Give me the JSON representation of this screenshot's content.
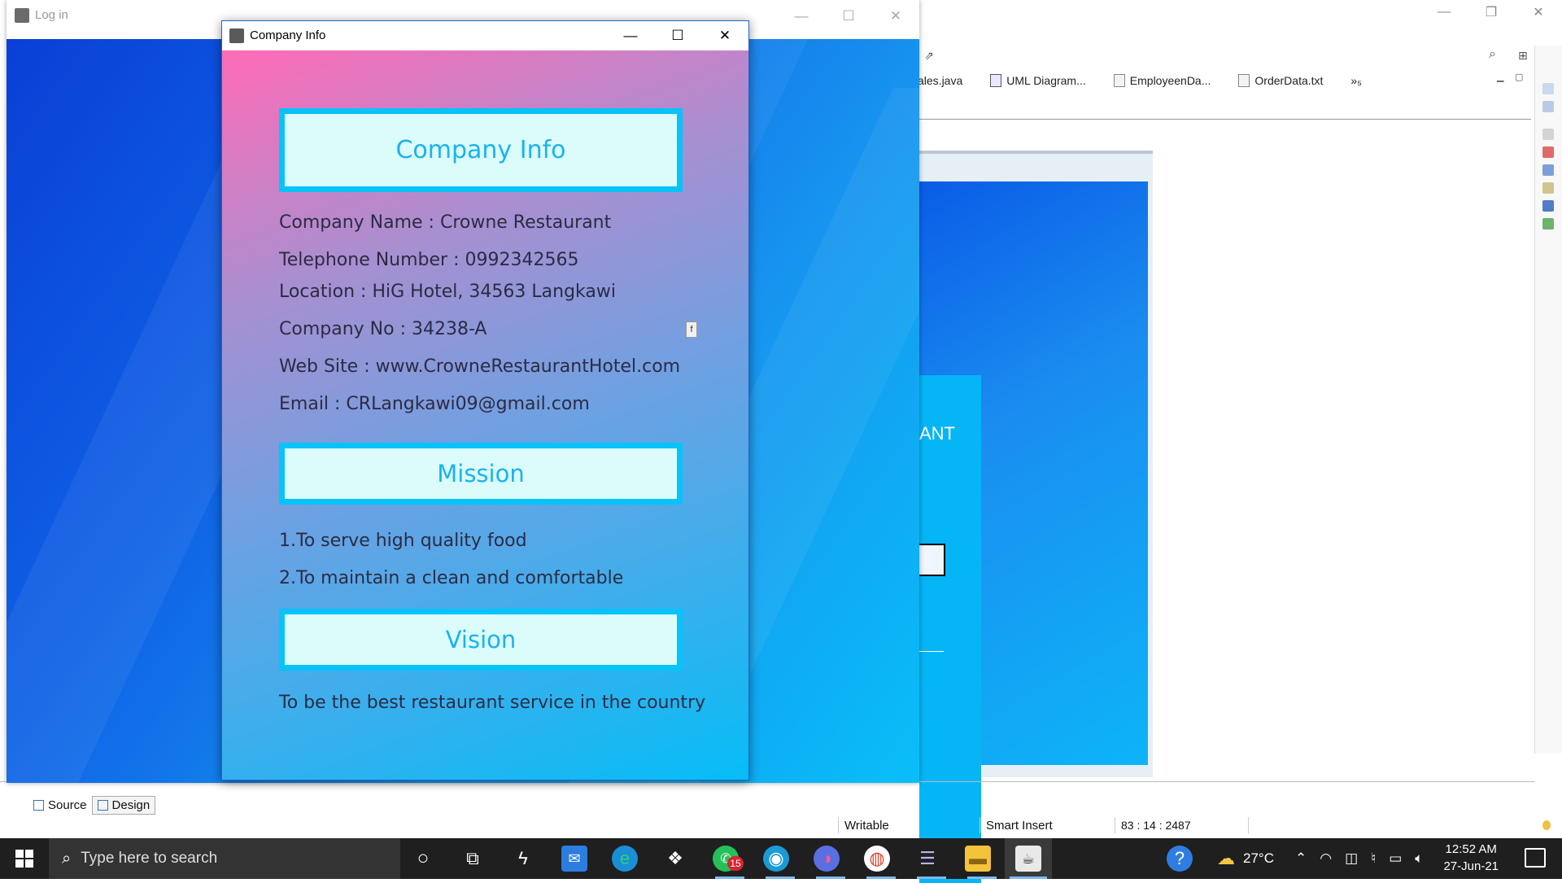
{
  "ide": {
    "editor_tabs": [
      {
        "label": "ales.java"
      },
      {
        "label": "UML Diagram..."
      },
      {
        "label": "EmployeenDa..."
      },
      {
        "label": "OrderData.txt"
      }
    ],
    "more_tabs": "»₅",
    "canvas_partial_text": "ANT",
    "source_tab": "Source",
    "design_tab": "Design",
    "status": {
      "writable": "Writable",
      "insert_mode": "Smart Insert",
      "position": "83 : 14 : 2487"
    }
  },
  "login_window": {
    "title": "Log in"
  },
  "company_window": {
    "title": "Company Info",
    "header": "Company Info",
    "lines": [
      "Company Name : Crowne Restaurant",
      "Telephone Number : 0992342565",
      "Location : HiG Hotel, 34563 Langkawi",
      "Company No : 34238-A",
      "Web Site : www.CrowneRestaurantHotel.com",
      "Email : CRLangkawi09@gmail.com"
    ],
    "small_button": "f",
    "mission_header": "Mission",
    "mission_lines": [
      "1.To serve high quality food",
      "2.To maintain a clean and comfortable"
    ],
    "vision_header": "Vision",
    "vision_line": "To be the best restaurant service in the country"
  },
  "taskbar": {
    "search_placeholder": "Type here to search",
    "whatsapp_badge": "15",
    "temperature": "27°C",
    "time": "12:52 AM",
    "date": "27-Jun-21"
  }
}
